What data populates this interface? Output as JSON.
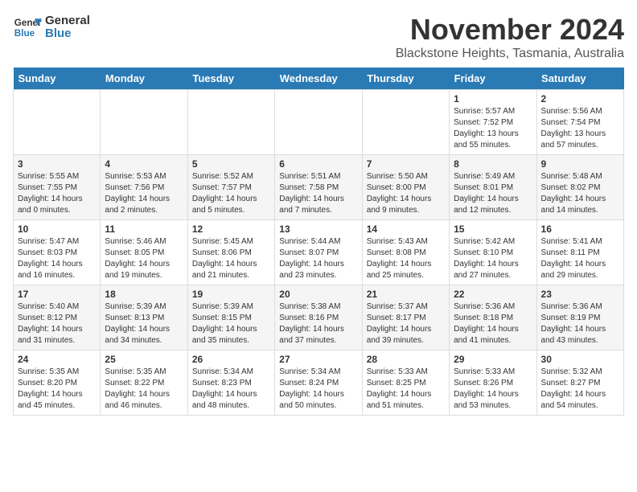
{
  "logo": {
    "line1": "General",
    "line2": "Blue"
  },
  "title": "November 2024",
  "location": "Blackstone Heights, Tasmania, Australia",
  "days_header": [
    "Sunday",
    "Monday",
    "Tuesday",
    "Wednesday",
    "Thursday",
    "Friday",
    "Saturday"
  ],
  "weeks": [
    [
      {
        "day": "",
        "info": ""
      },
      {
        "day": "",
        "info": ""
      },
      {
        "day": "",
        "info": ""
      },
      {
        "day": "",
        "info": ""
      },
      {
        "day": "",
        "info": ""
      },
      {
        "day": "1",
        "info": "Sunrise: 5:57 AM\nSunset: 7:52 PM\nDaylight: 13 hours and 55 minutes."
      },
      {
        "day": "2",
        "info": "Sunrise: 5:56 AM\nSunset: 7:54 PM\nDaylight: 13 hours and 57 minutes."
      }
    ],
    [
      {
        "day": "3",
        "info": "Sunrise: 5:55 AM\nSunset: 7:55 PM\nDaylight: 14 hours and 0 minutes."
      },
      {
        "day": "4",
        "info": "Sunrise: 5:53 AM\nSunset: 7:56 PM\nDaylight: 14 hours and 2 minutes."
      },
      {
        "day": "5",
        "info": "Sunrise: 5:52 AM\nSunset: 7:57 PM\nDaylight: 14 hours and 5 minutes."
      },
      {
        "day": "6",
        "info": "Sunrise: 5:51 AM\nSunset: 7:58 PM\nDaylight: 14 hours and 7 minutes."
      },
      {
        "day": "7",
        "info": "Sunrise: 5:50 AM\nSunset: 8:00 PM\nDaylight: 14 hours and 9 minutes."
      },
      {
        "day": "8",
        "info": "Sunrise: 5:49 AM\nSunset: 8:01 PM\nDaylight: 14 hours and 12 minutes."
      },
      {
        "day": "9",
        "info": "Sunrise: 5:48 AM\nSunset: 8:02 PM\nDaylight: 14 hours and 14 minutes."
      }
    ],
    [
      {
        "day": "10",
        "info": "Sunrise: 5:47 AM\nSunset: 8:03 PM\nDaylight: 14 hours and 16 minutes."
      },
      {
        "day": "11",
        "info": "Sunrise: 5:46 AM\nSunset: 8:05 PM\nDaylight: 14 hours and 19 minutes."
      },
      {
        "day": "12",
        "info": "Sunrise: 5:45 AM\nSunset: 8:06 PM\nDaylight: 14 hours and 21 minutes."
      },
      {
        "day": "13",
        "info": "Sunrise: 5:44 AM\nSunset: 8:07 PM\nDaylight: 14 hours and 23 minutes."
      },
      {
        "day": "14",
        "info": "Sunrise: 5:43 AM\nSunset: 8:08 PM\nDaylight: 14 hours and 25 minutes."
      },
      {
        "day": "15",
        "info": "Sunrise: 5:42 AM\nSunset: 8:10 PM\nDaylight: 14 hours and 27 minutes."
      },
      {
        "day": "16",
        "info": "Sunrise: 5:41 AM\nSunset: 8:11 PM\nDaylight: 14 hours and 29 minutes."
      }
    ],
    [
      {
        "day": "17",
        "info": "Sunrise: 5:40 AM\nSunset: 8:12 PM\nDaylight: 14 hours and 31 minutes."
      },
      {
        "day": "18",
        "info": "Sunrise: 5:39 AM\nSunset: 8:13 PM\nDaylight: 14 hours and 34 minutes."
      },
      {
        "day": "19",
        "info": "Sunrise: 5:39 AM\nSunset: 8:15 PM\nDaylight: 14 hours and 35 minutes."
      },
      {
        "day": "20",
        "info": "Sunrise: 5:38 AM\nSunset: 8:16 PM\nDaylight: 14 hours and 37 minutes."
      },
      {
        "day": "21",
        "info": "Sunrise: 5:37 AM\nSunset: 8:17 PM\nDaylight: 14 hours and 39 minutes."
      },
      {
        "day": "22",
        "info": "Sunrise: 5:36 AM\nSunset: 8:18 PM\nDaylight: 14 hours and 41 minutes."
      },
      {
        "day": "23",
        "info": "Sunrise: 5:36 AM\nSunset: 8:19 PM\nDaylight: 14 hours and 43 minutes."
      }
    ],
    [
      {
        "day": "24",
        "info": "Sunrise: 5:35 AM\nSunset: 8:20 PM\nDaylight: 14 hours and 45 minutes."
      },
      {
        "day": "25",
        "info": "Sunrise: 5:35 AM\nSunset: 8:22 PM\nDaylight: 14 hours and 46 minutes."
      },
      {
        "day": "26",
        "info": "Sunrise: 5:34 AM\nSunset: 8:23 PM\nDaylight: 14 hours and 48 minutes."
      },
      {
        "day": "27",
        "info": "Sunrise: 5:34 AM\nSunset: 8:24 PM\nDaylight: 14 hours and 50 minutes."
      },
      {
        "day": "28",
        "info": "Sunrise: 5:33 AM\nSunset: 8:25 PM\nDaylight: 14 hours and 51 minutes."
      },
      {
        "day": "29",
        "info": "Sunrise: 5:33 AM\nSunset: 8:26 PM\nDaylight: 14 hours and 53 minutes."
      },
      {
        "day": "30",
        "info": "Sunrise: 5:32 AM\nSunset: 8:27 PM\nDaylight: 14 hours and 54 minutes."
      }
    ]
  ]
}
